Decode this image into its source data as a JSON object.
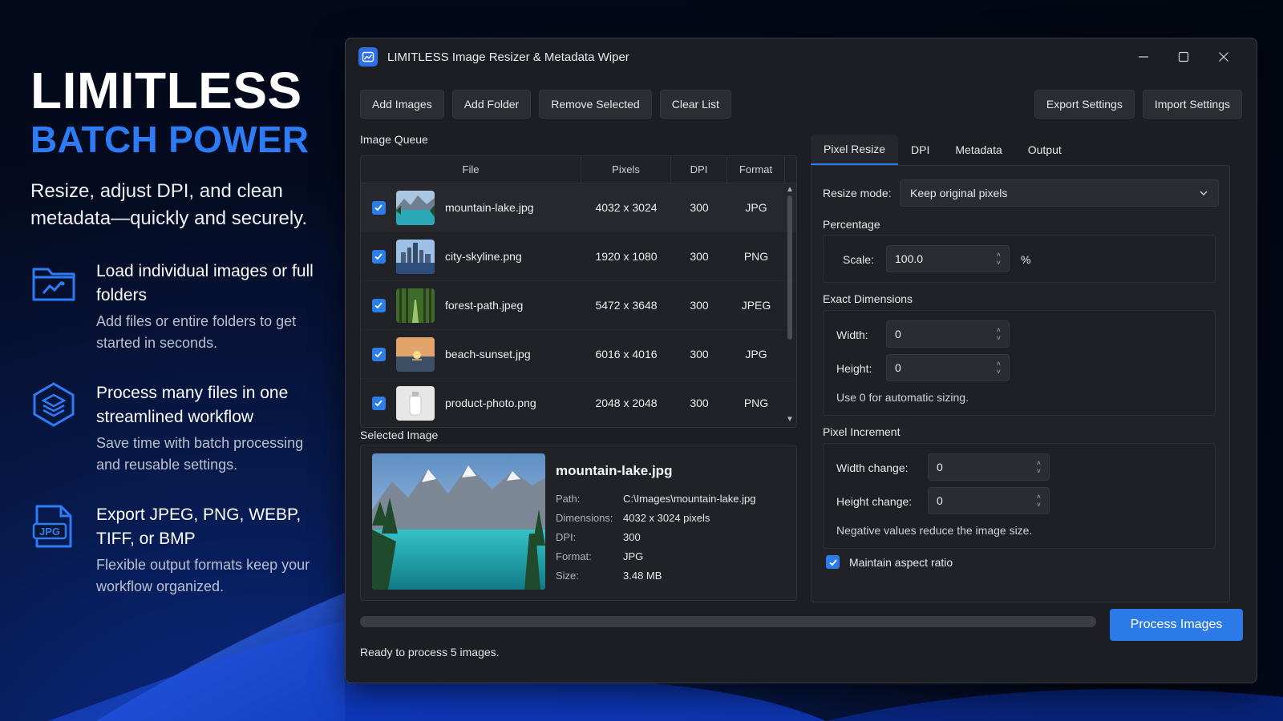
{
  "promo": {
    "title": "LIMITLESS",
    "subtitle": "BATCH POWER",
    "tagline": "Resize, adjust DPI, and clean metadata—quickly and securely.",
    "features": [
      {
        "icon": "folder-image-icon",
        "title": "Load individual images or full folders",
        "desc": "Add files or entire folders to get started in seconds."
      },
      {
        "icon": "layers-icon",
        "title": "Process many files in one streamlined workflow",
        "desc": "Save time with batch processing and reusable settings."
      },
      {
        "icon": "jpg-file-icon",
        "title": "Export JPEG, PNG, WEBP, TIFF, or BMP",
        "desc": "Flexible output formats keep your workflow organized."
      }
    ],
    "jpg_badge": "JPG"
  },
  "window": {
    "title": "LIMITLESS Image Resizer & Metadata Wiper"
  },
  "toolbar": {
    "add_images": "Add Images",
    "add_folder": "Add Folder",
    "remove_selected": "Remove Selected",
    "clear_list": "Clear List",
    "export_settings": "Export Settings",
    "import_settings": "Import Settings"
  },
  "queue": {
    "label": "Image Queue",
    "columns": {
      "file": "File",
      "pixels": "Pixels",
      "dpi": "DPI",
      "format": "Format"
    },
    "rows": [
      {
        "file": "mountain-lake.jpg",
        "pixels": "4032 x 3024",
        "dpi": "300",
        "format": "JPG",
        "checked": true
      },
      {
        "file": "city-skyline.png",
        "pixels": "1920 x 1080",
        "dpi": "300",
        "format": "PNG",
        "checked": true
      },
      {
        "file": "forest-path.jpeg",
        "pixels": "5472 x 3648",
        "dpi": "300",
        "format": "JPEG",
        "checked": true
      },
      {
        "file": "beach-sunset.jpg",
        "pixels": "6016 x 4016",
        "dpi": "300",
        "format": "JPG",
        "checked": true
      },
      {
        "file": "product-photo.png",
        "pixels": "2048 x 2048",
        "dpi": "300",
        "format": "PNG",
        "checked": true
      }
    ]
  },
  "selected": {
    "label": "Selected Image",
    "name": "mountain-lake.jpg",
    "path_label": "Path:",
    "path": "C:\\Images\\mountain-lake.jpg",
    "dimensions_label": "Dimensions:",
    "dimensions": "4032 x 3024 pixels",
    "dpi_label": "DPI:",
    "dpi": "300",
    "format_label": "Format:",
    "format": "JPG",
    "size_label": "Size:",
    "size": "3.48 MB"
  },
  "settings": {
    "tabs": [
      "Pixel Resize",
      "DPI",
      "Metadata",
      "Output"
    ],
    "active_tab": "Pixel Resize",
    "resize_mode_label": "Resize mode:",
    "resize_mode": "Keep original pixels",
    "percentage_label": "Percentage",
    "scale_label": "Scale:",
    "scale": "100.0",
    "scale_unit": "%",
    "exact_label": "Exact Dimensions",
    "width_label": "Width:",
    "width": "0",
    "height_label": "Height:",
    "height": "0",
    "exact_hint": "Use 0 for automatic sizing.",
    "increment_label": "Pixel Increment",
    "width_change_label": "Width change:",
    "width_change": "0",
    "height_change_label": "Height change:",
    "height_change": "0",
    "increment_hint": "Negative values reduce the image size.",
    "aspect_label": "Maintain aspect ratio",
    "aspect_checked": true
  },
  "footer": {
    "progress": 0,
    "process_button": "Process Images",
    "status": "Ready to process 5 images."
  },
  "colors": {
    "accent": "#2d7cf6",
    "window_bg": "#1c1e23",
    "panel_bg": "#202227"
  }
}
